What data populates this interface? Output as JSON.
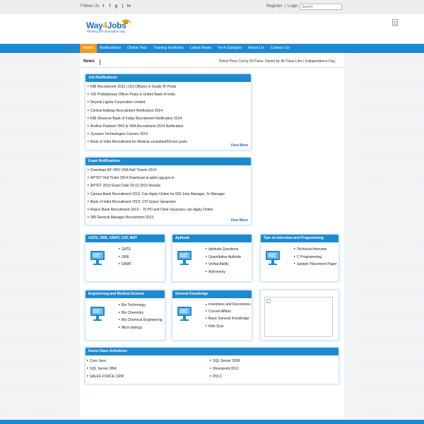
{
  "topbar": {
    "follow_label": "Follow Us",
    "register": "Register",
    "sep": "|",
    "login": "Login",
    "search_placeholder": "Search"
  },
  "logo": {
    "name_a": "Way",
    "name_b": "4",
    "name_c": "Jobs",
    "tagline": "Thinking the innovative way"
  },
  "nav": [
    "Home",
    "Notifications",
    "Online Test",
    "Training Institutes",
    "Latest News",
    "Tech Gadgets",
    "About Us",
    "Contact Us"
  ],
  "news": {
    "label": "News",
    "ticker": "Petrol Price Cut by 50 Paise, Diesel by 46 Paise Litre  |  Independence Day,"
  },
  "job_notifications": {
    "title": "Job Notifications",
    "items": [
      "RBI Recruitment 2016 | 163 Officers in Grade 'B' Posts",
      "100 Probationary Officer Posts in United Bank of India",
      "Neyveli Lignite Corporation Limited",
      "Central Railway Recruitment Notification 2014",
      "RBI (Reserve Bank of India) Recruitment Notification 2014",
      "Andhra Pradesh VRO & VRA Recruitment 2014 Notification",
      "Zyxware Technologies Careers 2013",
      "Bank of India Recruitment for Medical consultant/Doctor posts"
    ],
    "view_more": "View More"
  },
  "exam_notifications": {
    "title": "Exam Notifications",
    "items": [
      "Download AP VRO VRA Hall Tickets 2014",
      "APTET Hall Ticket 2014 Download at aptet.cgg.gov.in",
      "APTET 2013 Exam Date 29.12.2013 Results",
      "Canara Bank Recruitment 2013: Can Apply Online for 550 Jobs Manager, Sr Manager",
      "Bank of India Recruitment 2013: 170 Sepoy Vacancies",
      "Repco Bank Recruitment 2013 – 75 PO and Clerk Vacancies can Apply Online",
      "SBI General Manager Recruitment 2013"
    ],
    "view_more": "View More"
  },
  "boxes": {
    "gate": {
      "title": "GATE, GRE, GMAT, CAT, MAT",
      "items": [
        "GATE",
        "GRE",
        "GMAT"
      ]
    },
    "aptitude": {
      "title": "Aptitude",
      "items": [
        "Aptitude Questions",
        "Quantitative Aptitude",
        "Verbal Ability",
        "Astronomy"
      ]
    },
    "tips": {
      "title": "Tips on Interview and Programming",
      "items": [
        "Technical Interview",
        "C Programming",
        "Sample Placement Paper"
      ]
    },
    "engineering": {
      "title": "Engineering and Medical Science",
      "items": [
        "Bio Technology",
        "Bio Chemistry",
        "Bio Chemical Engineering",
        "Micro biology"
      ]
    },
    "gk": {
      "title": "General Knowledge",
      "items": [
        "Inventions and Discoveries",
        "Current Affairs",
        "Basic General Knowledge",
        "Kids Quiz"
      ]
    }
  },
  "demo": {
    "title": "Demo Class Schedules",
    "left": [
      "Core Java",
      "SQL Server DBA",
      "SALES FORCE CRM"
    ],
    "right": [
      "SQL Server 2008",
      "Sharepoint 2013",
      "PDLC"
    ]
  },
  "colors": {
    "primary": "#1d8ad0",
    "accent": "#f29c1f"
  }
}
